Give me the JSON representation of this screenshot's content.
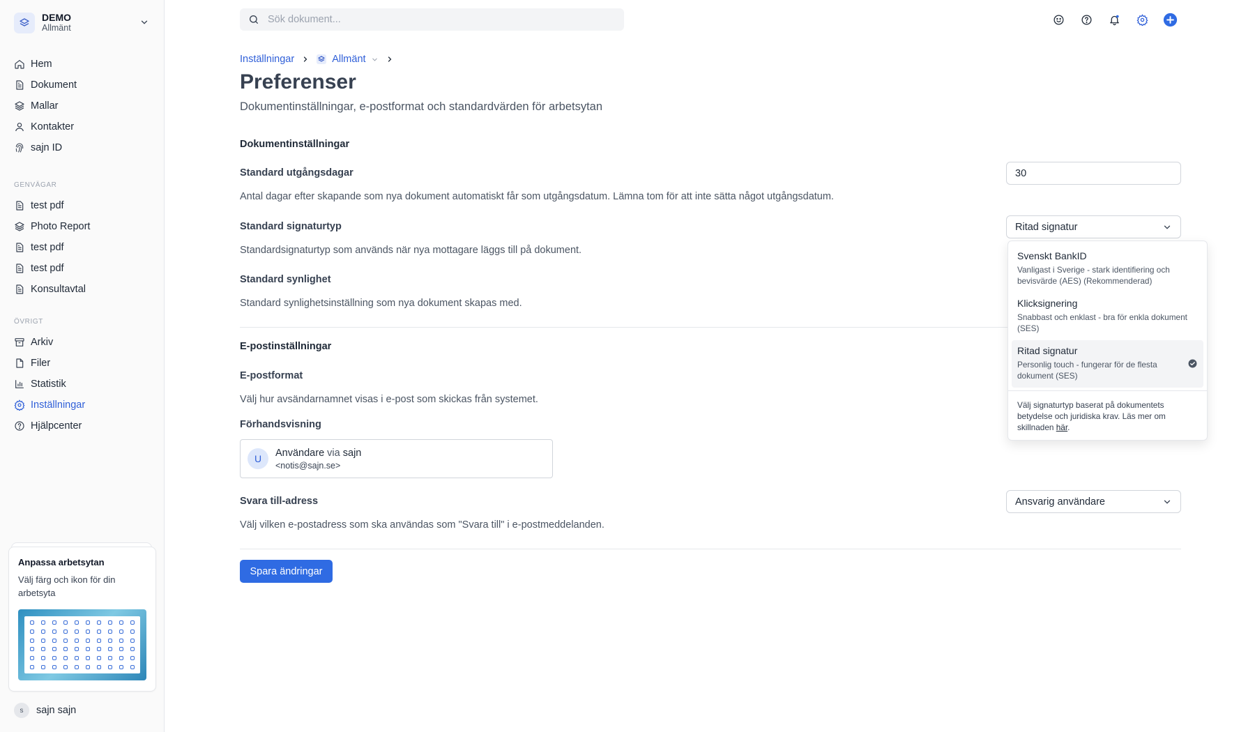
{
  "workspace": {
    "name": "DEMO",
    "sub": "Allmänt"
  },
  "nav": {
    "main": [
      {
        "label": "Hem",
        "icon": "home-icon"
      },
      {
        "label": "Dokument",
        "icon": "document-icon"
      },
      {
        "label": "Mallar",
        "icon": "layers-icon"
      },
      {
        "label": "Kontakter",
        "icon": "user-icon"
      },
      {
        "label": "sajn ID",
        "icon": "fingerprint-icon"
      }
    ],
    "shortcuts_heading": "GENVÄGAR",
    "shortcuts": [
      {
        "label": "test pdf",
        "icon": "document-icon"
      },
      {
        "label": "Photo Report",
        "icon": "layers-icon"
      },
      {
        "label": "test pdf",
        "icon": "document-icon"
      },
      {
        "label": "test pdf",
        "icon": "document-icon"
      },
      {
        "label": "Konsultavtal",
        "icon": "document-icon"
      }
    ],
    "other_heading": "ÖVRIGT",
    "other": [
      {
        "label": "Arkiv",
        "icon": "archive-icon"
      },
      {
        "label": "Filer",
        "icon": "file-icon"
      },
      {
        "label": "Statistik",
        "icon": "chart-icon"
      },
      {
        "label": "Inställningar",
        "icon": "gear-icon",
        "active": true
      },
      {
        "label": "Hjälpcenter",
        "icon": "help-icon"
      }
    ]
  },
  "promo": {
    "title": "Anpassa arbetsytan",
    "text": "Välj färg och ikon för din arbetsyta"
  },
  "user": {
    "initial": "s",
    "name": "sajn sajn"
  },
  "search": {
    "placeholder": "Sök dokument..."
  },
  "breadcrumb": {
    "root": "Inställningar",
    "current": "Allmänt"
  },
  "page": {
    "title": "Preferenser",
    "subtitle": "Dokumentinställningar, e-postformat och standardvärden för arbetsytan"
  },
  "documents_section": {
    "title": "Dokumentinställningar",
    "expiry_label": "Standard utgångsdagar",
    "expiry_value": "30",
    "expiry_desc": "Antal dagar efter skapande som nya dokument automatiskt får som utgångsdatum. Lämna tom för att inte sätta något utgångsdatum.",
    "signature_label": "Standard signaturtyp",
    "signature_value": "Ritad signatur",
    "signature_desc": "Standardsignaturtyp som används när nya mottagare läggs till på dokument.",
    "visibility_label": "Standard synlighet",
    "visibility_desc": "Standard synlighetsinställning som nya dokument skapas med."
  },
  "email_section": {
    "title": "E-postinställningar",
    "format_label": "E-postformat",
    "format_desc": "Välj hur avsändarnamnet visas i e-post som skickas från systemet.",
    "preview_label": "Förhandsvisning",
    "preview": {
      "initial": "U",
      "name": "Användare",
      "via": "via",
      "brand": "sajn",
      "address": "<notis@sajn.se>"
    },
    "reply_label": "Svara till-adress",
    "reply_value": "Ansvarig användare",
    "reply_desc": "Välj vilken e-postadress som ska användas som \"Svara till\" i e-postmeddelanden."
  },
  "save_button": "Spara ändringar",
  "signature_dropdown": {
    "options": [
      {
        "title": "Svenskt BankID",
        "desc": "Vanligast i Sverige - stark identifiering och bevisvärde (AES) (Rekommenderad)"
      },
      {
        "title": "Klicksignering",
        "desc": "Snabbast och enklast - bra för enkla dokument (SES)"
      },
      {
        "title": "Ritad signatur",
        "desc": "Personlig touch - fungerar för de flesta dokument (SES)",
        "selected": true
      }
    ],
    "footer_text": "Välj signaturtyp baserat på dokumentets betydelse och juridiska krav. Läs mer om skillnaden",
    "footer_link": "här",
    "footer_end": "."
  },
  "colors": {
    "accent": "#2f5fd8",
    "button": "#2f6be3"
  }
}
